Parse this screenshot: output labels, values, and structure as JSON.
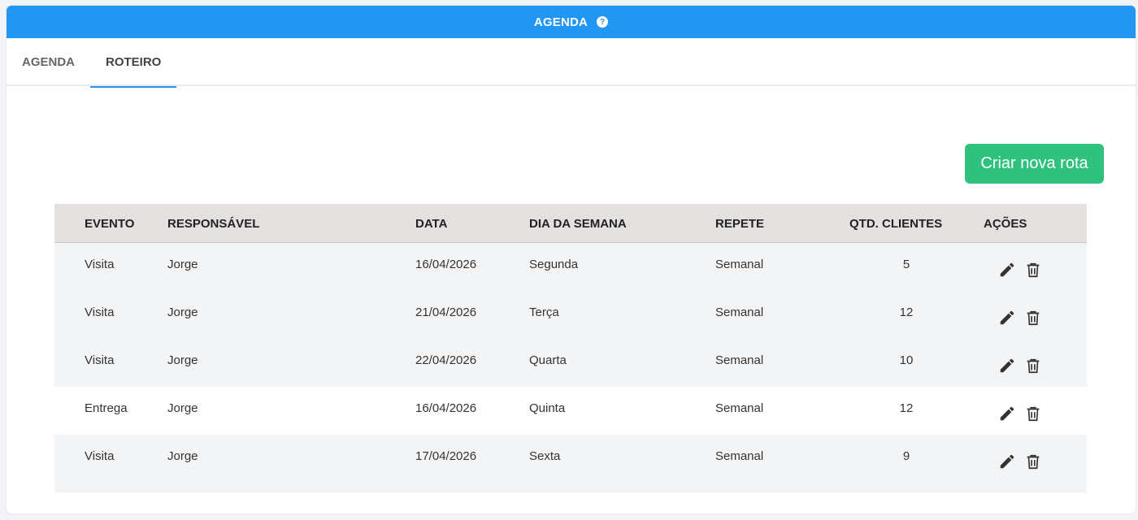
{
  "header": {
    "title": "AGENDA",
    "help_glyph": "?"
  },
  "tabs": [
    {
      "label": "AGENDA",
      "active": false
    },
    {
      "label": "ROTEIRO",
      "active": true
    }
  ],
  "create_button_label": "Criar nova rota",
  "colors": {
    "header_bg": "#2196f3",
    "create_button_bg": "#2ec27e",
    "table_header_bg": "#e3e0df"
  },
  "table": {
    "columns": [
      "EVENTO",
      "RESPONSÁVEL",
      "DATA",
      "DIA DA SEMANA",
      "REPETE",
      "QTD. CLIENTES",
      "AÇÕES"
    ],
    "rows": [
      {
        "evento": "Visita",
        "responsavel": "Jorge",
        "data": "16/04/2026",
        "dia": "Segunda",
        "repete": "Semanal",
        "qtd": "5"
      },
      {
        "evento": "Visita",
        "responsavel": "Jorge",
        "data": "21/04/2026",
        "dia": "Terça",
        "repete": "Semanal",
        "qtd": "12"
      },
      {
        "evento": "Visita",
        "responsavel": "Jorge",
        "data": "22/04/2026",
        "dia": "Quarta",
        "repete": "Semanal",
        "qtd": "10"
      },
      {
        "evento": "Entrega",
        "responsavel": "Jorge",
        "data": "16/04/2026",
        "dia": "Quinta",
        "repete": "Semanal",
        "qtd": "12"
      },
      {
        "evento": "Visita",
        "responsavel": "Jorge",
        "data": "17/04/2026",
        "dia": "Sexta",
        "repete": "Semanal",
        "qtd": "9"
      }
    ],
    "row_icons": [
      "pencil-icon",
      "trash-icon"
    ]
  }
}
